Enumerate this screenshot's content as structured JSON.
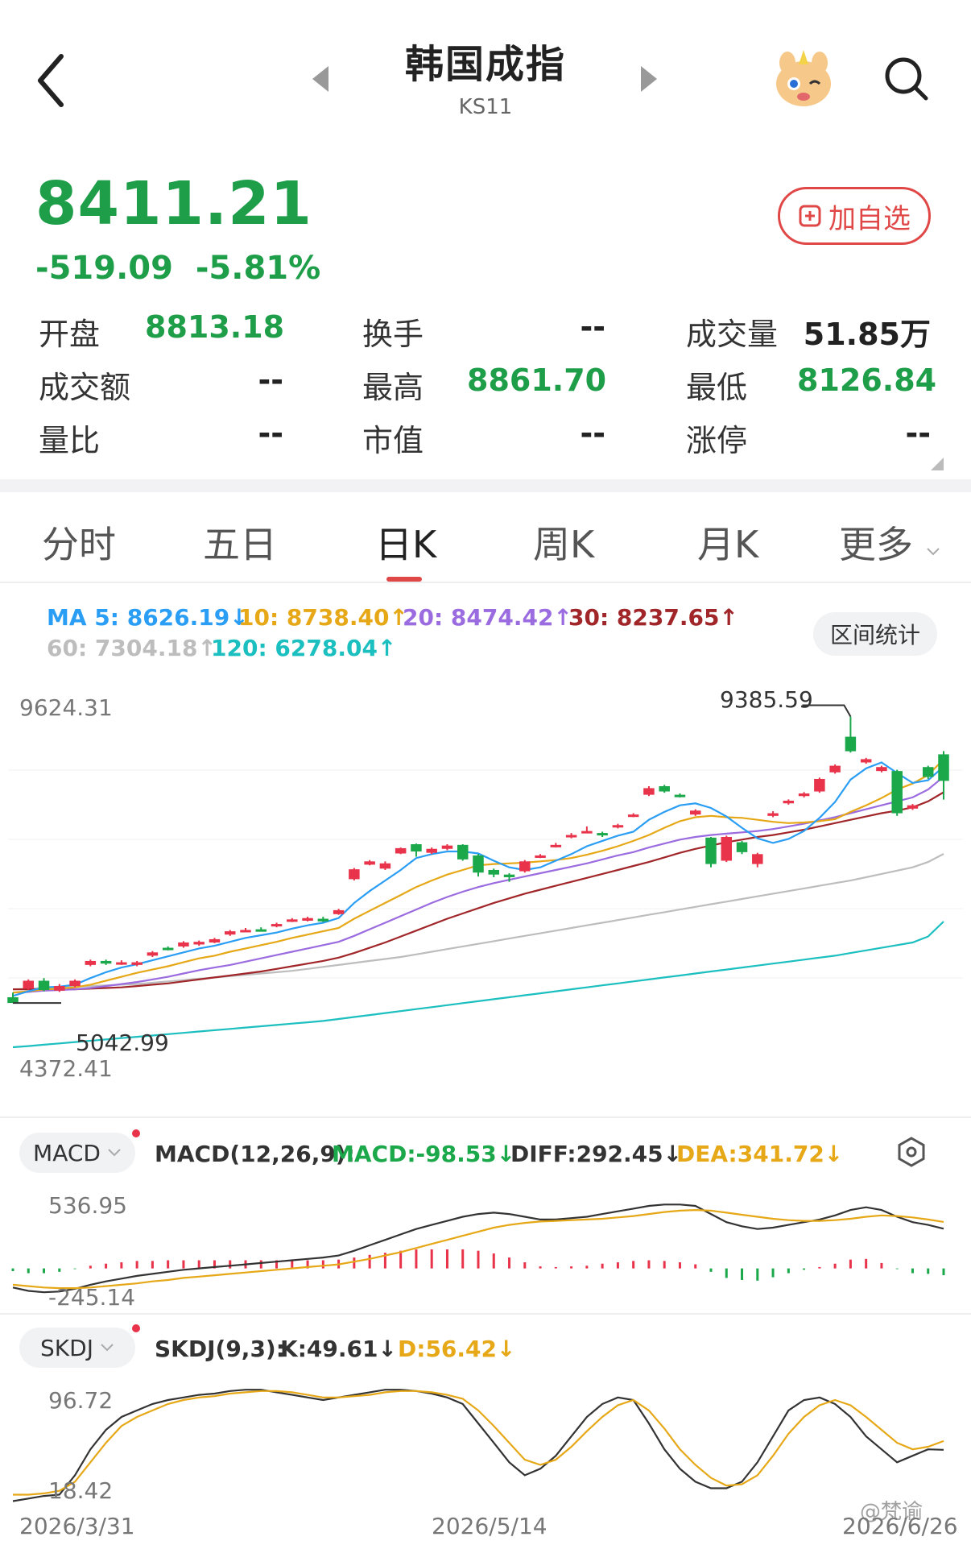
{
  "header": {
    "title": "韩国成指",
    "code": "KS11"
  },
  "quote": {
    "price": "8411.21",
    "change": "-519.09",
    "change_pct": "-5.81%",
    "add_watch_label": "加自选"
  },
  "stats": {
    "open_label": "开盘",
    "open_value": "8813.18",
    "turnover_label": "换手",
    "turnover_value": "--",
    "volume_label": "成交量",
    "volume_value": "51.85万",
    "amount_label": "成交额",
    "amount_value": "--",
    "high_label": "最高",
    "high_value": "8861.70",
    "low_label": "最低",
    "low_value": "8126.84",
    "ratio_label": "量比",
    "ratio_value": "--",
    "mktcap_label": "市值",
    "mktcap_value": "--",
    "limitup_label": "涨停",
    "limitup_value": "--"
  },
  "tabs": [
    "分时",
    "五日",
    "日K",
    "周K",
    "月K",
    "更多"
  ],
  "active_tab": "日K",
  "ma_legend": {
    "ma5": "MA 5: 8626.19↓",
    "ma10": "10: 8738.40↑",
    "ma20": "20: 8474.42↑",
    "ma30": "30: 8237.65↑",
    "ma60": "60: 7304.18↑",
    "ma120": "120: 6278.04↑"
  },
  "range_stats_label": "区间统计",
  "colors": {
    "up": "#e8334a",
    "down": "#1aa84a",
    "ma5": "#2a9df4",
    "ma10": "#e6a817",
    "ma20": "#9b6be0",
    "ma30": "#a0262a",
    "ma60": "#bdbdbd",
    "ma120": "#1cbfbf"
  },
  "main_chart": {
    "y_top_label": "9624.31",
    "y_bottom_label": "4372.41",
    "high_marker": "9385.59",
    "low_marker": "5042.99"
  },
  "macd_panel": {
    "selector": "MACD",
    "params": "MACD(12,26,9):",
    "macd": "MACD:-98.53↓",
    "diff": "DIFF:292.45↓",
    "dea": "DEA:341.72↓",
    "y_top": "536.95",
    "y_bottom": "-245.14"
  },
  "skdj_panel": {
    "selector": "SKDJ",
    "params": "SKDJ(9,3):",
    "k": "K:49.61↓",
    "d": "D:56.42↓",
    "y_top": "96.72",
    "y_bottom": "18.42"
  },
  "x_axis": [
    "2026/3/31",
    "2026/5/14",
    "2026/6/26"
  ],
  "watermark": "@梵谕",
  "chart_data": {
    "type": "candlestick",
    "candles": [
      {
        "o": 5130,
        "c": 5043,
        "h": 5200,
        "l": 5043
      },
      {
        "o": 5260,
        "c": 5380,
        "h": 5400,
        "l": 5240
      },
      {
        "o": 5380,
        "c": 5240,
        "h": 5420,
        "l": 5220
      },
      {
        "o": 5230,
        "c": 5300,
        "h": 5330,
        "l": 5210
      },
      {
        "o": 5300,
        "c": 5380,
        "h": 5400,
        "l": 5280
      },
      {
        "o": 5620,
        "c": 5680,
        "h": 5700,
        "l": 5600
      },
      {
        "o": 5680,
        "c": 5640,
        "h": 5700,
        "l": 5620
      },
      {
        "o": 5640,
        "c": 5660,
        "h": 5690,
        "l": 5620
      },
      {
        "o": 5620,
        "c": 5660,
        "h": 5680,
        "l": 5600
      },
      {
        "o": 5760,
        "c": 5810,
        "h": 5830,
        "l": 5740
      },
      {
        "o": 5880,
        "c": 5860,
        "h": 5900,
        "l": 5840
      },
      {
        "o": 5900,
        "c": 5960,
        "h": 5980,
        "l": 5880
      },
      {
        "o": 5930,
        "c": 5970,
        "h": 5990,
        "l": 5910
      },
      {
        "o": 5960,
        "c": 6010,
        "h": 6030,
        "l": 5950
      },
      {
        "o": 6080,
        "c": 6130,
        "h": 6150,
        "l": 6060
      },
      {
        "o": 6140,
        "c": 6150,
        "h": 6180,
        "l": 6120
      },
      {
        "o": 6160,
        "c": 6150,
        "h": 6190,
        "l": 6140
      },
      {
        "o": 6210,
        "c": 6240,
        "h": 6260,
        "l": 6190
      },
      {
        "o": 6290,
        "c": 6310,
        "h": 6330,
        "l": 6270
      },
      {
        "o": 6290,
        "c": 6330,
        "h": 6350,
        "l": 6280
      },
      {
        "o": 6320,
        "c": 6280,
        "h": 6350,
        "l": 6270
      },
      {
        "o": 6390,
        "c": 6450,
        "h": 6470,
        "l": 6380
      },
      {
        "o": 6920,
        "c": 7070,
        "h": 7090,
        "l": 6900
      },
      {
        "o": 7140,
        "c": 7190,
        "h": 7210,
        "l": 7130
      },
      {
        "o": 7080,
        "c": 7160,
        "h": 7190,
        "l": 7060
      },
      {
        "o": 7310,
        "c": 7390,
        "h": 7400,
        "l": 7300
      },
      {
        "o": 7450,
        "c": 7340,
        "h": 7460,
        "l": 7260
      },
      {
        "o": 7320,
        "c": 7380,
        "h": 7400,
        "l": 7300
      },
      {
        "o": 7380,
        "c": 7430,
        "h": 7450,
        "l": 7360
      },
      {
        "o": 7440,
        "c": 7220,
        "h": 7450,
        "l": 7200
      },
      {
        "o": 7280,
        "c": 7020,
        "h": 7300,
        "l": 6960
      },
      {
        "o": 7060,
        "c": 6990,
        "h": 7080,
        "l": 6950
      },
      {
        "o": 6990,
        "c": 6950,
        "h": 7010,
        "l": 6880
      },
      {
        "o": 7040,
        "c": 7190,
        "h": 7210,
        "l": 7020
      },
      {
        "o": 7260,
        "c": 7280,
        "h": 7300,
        "l": 7240
      },
      {
        "o": 7420,
        "c": 7440,
        "h": 7470,
        "l": 7400
      },
      {
        "o": 7560,
        "c": 7590,
        "h": 7620,
        "l": 7540
      },
      {
        "o": 7630,
        "c": 7650,
        "h": 7720,
        "l": 7620
      },
      {
        "o": 7620,
        "c": 7600,
        "h": 7640,
        "l": 7560
      },
      {
        "o": 7710,
        "c": 7740,
        "h": 7760,
        "l": 7690
      },
      {
        "o": 7880,
        "c": 7900,
        "h": 7920,
        "l": 7860
      },
      {
        "o": 8200,
        "c": 8300,
        "h": 8330,
        "l": 8180
      },
      {
        "o": 8330,
        "c": 8250,
        "h": 8350,
        "l": 8230
      },
      {
        "o": 8200,
        "c": 8180,
        "h": 8220,
        "l": 8160
      },
      {
        "o": 7900,
        "c": 7960,
        "h": 7980,
        "l": 7880
      },
      {
        "o": 7550,
        "c": 7150,
        "h": 7560,
        "l": 7100
      },
      {
        "o": 7200,
        "c": 7560,
        "h": 7580,
        "l": 7180
      },
      {
        "o": 7480,
        "c": 7330,
        "h": 7500,
        "l": 7300
      },
      {
        "o": 7150,
        "c": 7300,
        "h": 7320,
        "l": 7100
      },
      {
        "o": 7880,
        "c": 7920,
        "h": 7950,
        "l": 7860
      },
      {
        "o": 8070,
        "c": 8110,
        "h": 8130,
        "l": 8050
      },
      {
        "o": 8180,
        "c": 8220,
        "h": 8240,
        "l": 8160
      },
      {
        "o": 8250,
        "c": 8440,
        "h": 8460,
        "l": 8230
      },
      {
        "o": 8540,
        "c": 8640,
        "h": 8660,
        "l": 8520
      },
      {
        "o": 9080,
        "c": 8860,
        "h": 9386,
        "l": 8840
      },
      {
        "o": 8690,
        "c": 8740,
        "h": 8760,
        "l": 8670
      },
      {
        "o": 8560,
        "c": 8620,
        "h": 8640,
        "l": 8540
      },
      {
        "o": 8560,
        "c": 7920,
        "h": 8580,
        "l": 7880
      },
      {
        "o": 7990,
        "c": 8040,
        "h": 8060,
        "l": 7970
      },
      {
        "o": 8620,
        "c": 8470,
        "h": 8640,
        "l": 8440
      },
      {
        "o": 8813,
        "c": 8411,
        "h": 8862,
        "l": 8127
      }
    ],
    "ma5": [
      5150,
      5220,
      5280,
      5290,
      5320,
      5420,
      5510,
      5580,
      5630,
      5690,
      5750,
      5810,
      5870,
      5910,
      5970,
      6030,
      6070,
      6110,
      6170,
      6220,
      6260,
      6330,
      6560,
      6740,
      6900,
      7060,
      7240,
      7300,
      7340,
      7340,
      7310,
      7200,
      7100,
      7060,
      7100,
      7200,
      7300,
      7420,
      7500,
      7580,
      7640,
      7820,
      7940,
      8040,
      8070,
      8000,
      7870,
      7700,
      7540,
      7470,
      7530,
      7650,
      7850,
      8090,
      8430,
      8600,
      8690,
      8530,
      8380,
      8420,
      8626
    ],
    "ma10": [
      5200,
      5220,
      5250,
      5260,
      5280,
      5320,
      5380,
      5440,
      5500,
      5550,
      5600,
      5660,
      5720,
      5760,
      5820,
      5870,
      5920,
      5970,
      6030,
      6080,
      6130,
      6180,
      6320,
      6440,
      6560,
      6680,
      6800,
      6900,
      6990,
      7060,
      7130,
      7150,
      7160,
      7170,
      7190,
      7210,
      7240,
      7290,
      7350,
      7420,
      7500,
      7590,
      7700,
      7800,
      7860,
      7880,
      7860,
      7850,
      7820,
      7790,
      7770,
      7780,
      7800,
      7830,
      7940,
      8040,
      8150,
      8280,
      8370,
      8500,
      8738
    ],
    "ma20": [
      5200,
      5210,
      5230,
      5240,
      5250,
      5270,
      5300,
      5330,
      5360,
      5400,
      5440,
      5490,
      5540,
      5580,
      5620,
      5670,
      5720,
      5770,
      5820,
      5870,
      5920,
      5970,
      6060,
      6160,
      6260,
      6360,
      6460,
      6560,
      6650,
      6730,
      6800,
      6860,
      6910,
      6960,
      7010,
      7060,
      7110,
      7160,
      7220,
      7280,
      7330,
      7400,
      7460,
      7520,
      7560,
      7590,
      7610,
      7630,
      7650,
      7680,
      7720,
      7760,
      7810,
      7860,
      7920,
      7980,
      8040,
      8100,
      8160,
      8280,
      8474
    ],
    "ma30": [
      5250,
      5250,
      5250,
      5250,
      5250,
      5260,
      5270,
      5280,
      5300,
      5320,
      5340,
      5370,
      5400,
      5430,
      5460,
      5490,
      5520,
      5560,
      5600,
      5640,
      5680,
      5730,
      5800,
      5880,
      5960,
      6050,
      6140,
      6230,
      6320,
      6400,
      6480,
      6560,
      6630,
      6700,
      6760,
      6820,
      6880,
      6940,
      7000,
      7060,
      7120,
      7180,
      7250,
      7320,
      7380,
      7430,
      7480,
      7520,
      7560,
      7590,
      7630,
      7670,
      7720,
      7770,
      7820,
      7870,
      7920,
      7960,
      8010,
      8100,
      8238
    ],
    "ma60": [
      5250,
      5260,
      5270,
      5280,
      5290,
      5300,
      5310,
      5320,
      5330,
      5350,
      5370,
      5390,
      5410,
      5430,
      5450,
      5470,
      5490,
      5510,
      5530,
      5560,
      5590,
      5620,
      5650,
      5680,
      5710,
      5740,
      5780,
      5820,
      5860,
      5900,
      5940,
      5980,
      6020,
      6060,
      6100,
      6140,
      6180,
      6220,
      6260,
      6300,
      6340,
      6380,
      6420,
      6460,
      6500,
      6540,
      6580,
      6620,
      6660,
      6700,
      6740,
      6780,
      6820,
      6860,
      6900,
      6950,
      7000,
      7050,
      7100,
      7180,
      7304
    ],
    "ma120": [
      4372,
      4390,
      4410,
      4430,
      4450,
      4470,
      4490,
      4510,
      4530,
      4550,
      4570,
      4590,
      4610,
      4630,
      4650,
      4670,
      4690,
      4710,
      4730,
      4750,
      4770,
      4800,
      4830,
      4860,
      4890,
      4920,
      4950,
      4980,
      5010,
      5040,
      5070,
      5100,
      5130,
      5160,
      5190,
      5220,
      5250,
      5280,
      5310,
      5340,
      5370,
      5400,
      5430,
      5460,
      5490,
      5520,
      5550,
      5580,
      5610,
      5640,
      5670,
      5700,
      5730,
      5760,
      5800,
      5840,
      5880,
      5920,
      5960,
      6050,
      6278
    ],
    "y_range": [
      4372.41,
      9624.31
    ],
    "macd": {
      "diff": [
        -140,
        -165,
        -175,
        -170,
        -150,
        -120,
        -95,
        -75,
        -55,
        -40,
        -25,
        -10,
        0,
        10,
        20,
        30,
        40,
        50,
        60,
        70,
        80,
        95,
        130,
        170,
        210,
        250,
        290,
        320,
        350,
        380,
        400,
        410,
        400,
        380,
        360,
        360,
        370,
        380,
        400,
        420,
        440,
        460,
        470,
        470,
        460,
        400,
        340,
        310,
        290,
        300,
        320,
        340,
        360,
        390,
        430,
        450,
        430,
        380,
        340,
        320,
        292
      ],
      "dea": [
        -120,
        -130,
        -140,
        -145,
        -145,
        -140,
        -130,
        -120,
        -110,
        -95,
        -85,
        -70,
        -60,
        -50,
        -40,
        -30,
        -20,
        -10,
        0,
        10,
        20,
        30,
        50,
        70,
        95,
        120,
        150,
        180,
        210,
        240,
        270,
        300,
        320,
        335,
        345,
        350,
        355,
        360,
        365,
        375,
        385,
        400,
        415,
        425,
        430,
        425,
        410,
        395,
        380,
        365,
        355,
        350,
        350,
        355,
        365,
        380,
        390,
        385,
        375,
        360,
        342
      ],
      "y_range": [
        -245.14,
        536.95
      ]
    },
    "skdj": {
      "k": [
        10,
        12,
        14,
        15,
        30,
        50,
        65,
        75,
        80,
        85,
        88,
        90,
        92,
        93,
        95,
        96,
        96,
        94,
        92,
        90,
        88,
        90,
        92,
        94,
        96,
        96,
        95,
        93,
        90,
        85,
        70,
        55,
        40,
        30,
        35,
        45,
        60,
        75,
        85,
        90,
        88,
        70,
        50,
        35,
        25,
        20,
        20,
        25,
        40,
        60,
        80,
        88,
        90,
        85,
        75,
        60,
        50,
        40,
        45,
        50,
        49.6
      ],
      "d": [
        15,
        15,
        16,
        18,
        25,
        40,
        55,
        68,
        75,
        80,
        85,
        88,
        90,
        91,
        93,
        94,
        95,
        95,
        94,
        92,
        90,
        90,
        91,
        92,
        94,
        95,
        95,
        94,
        92,
        89,
        80,
        68,
        55,
        42,
        38,
        42,
        52,
        64,
        75,
        84,
        88,
        80,
        66,
        50,
        38,
        28,
        22,
        23,
        30,
        45,
        62,
        75,
        84,
        88,
        84,
        75,
        65,
        55,
        50,
        52,
        56.4
      ],
      "y_range": [
        18.42,
        96.72
      ]
    }
  }
}
